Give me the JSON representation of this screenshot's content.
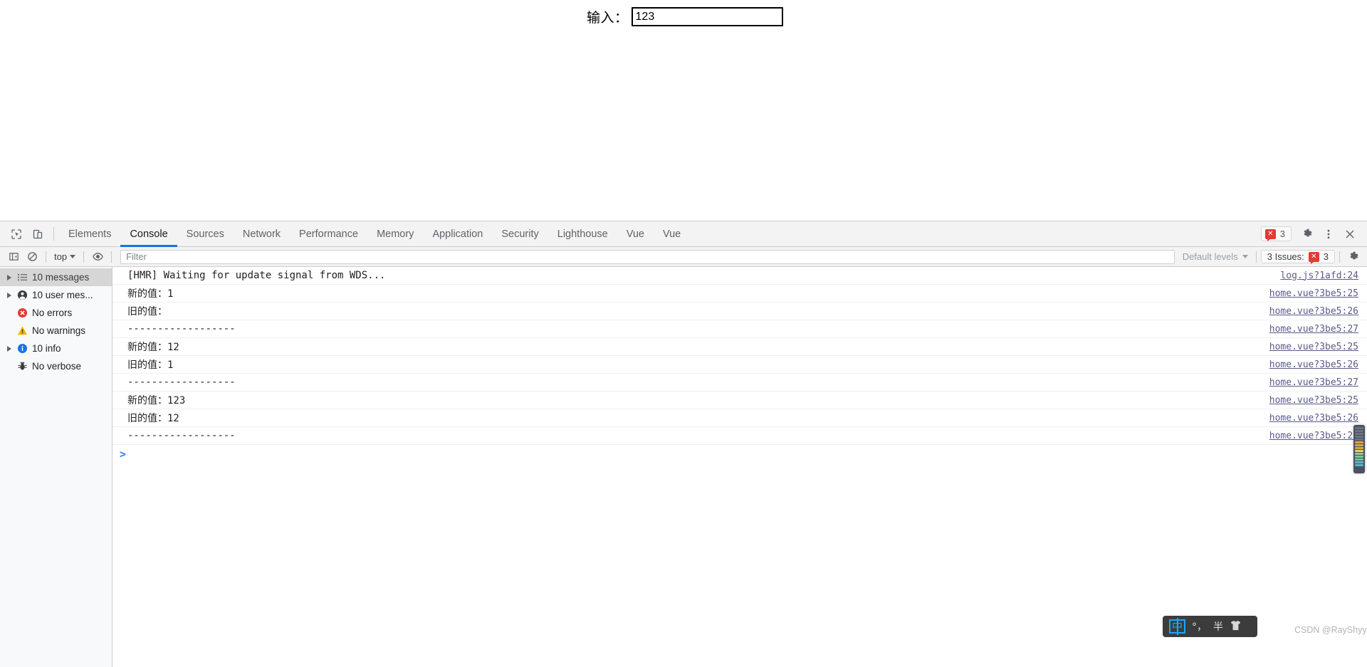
{
  "page": {
    "label": "输入：",
    "input_value": "123",
    "input_placeholder": ""
  },
  "devtools": {
    "tabs": [
      {
        "label": "Elements",
        "active": false
      },
      {
        "label": "Console",
        "active": true
      },
      {
        "label": "Sources",
        "active": false
      },
      {
        "label": "Network",
        "active": false
      },
      {
        "label": "Performance",
        "active": false
      },
      {
        "label": "Memory",
        "active": false
      },
      {
        "label": "Application",
        "active": false
      },
      {
        "label": "Security",
        "active": false
      },
      {
        "label": "Lighthouse",
        "active": false
      },
      {
        "label": "Vue",
        "active": false
      },
      {
        "label": "Vue",
        "active": false
      }
    ],
    "header_icons": {
      "inspect": "inspect-element-icon",
      "device": "device-toolbar-icon",
      "settings": "gear-icon",
      "more": "more-options-icon",
      "close": "close-icon"
    },
    "error_badge": {
      "count": "3",
      "icon": "error-icon"
    },
    "toolbar": {
      "sidebar_toggle": "console-sidebar-toggle-icon",
      "clear_console": "clear-console-icon",
      "context": "top",
      "eye": "live-expression-icon",
      "filter_placeholder": "Filter",
      "filter_value": "",
      "levels_label": "Default levels",
      "issues_label": "3 Issues:",
      "issues_count": "3",
      "settings": "gear-icon"
    },
    "sidebar": [
      {
        "label": "10 messages",
        "icon": "list-icon",
        "arrow": true,
        "selected": true,
        "color": "#5f6368"
      },
      {
        "label": "10 user mes...",
        "icon": "user-icon",
        "arrow": true,
        "selected": false,
        "color": "#3c4043"
      },
      {
        "label": "No errors",
        "icon": "error-icon",
        "arrow": false,
        "selected": false,
        "color": "#e53935"
      },
      {
        "label": "No warnings",
        "icon": "warning-icon",
        "arrow": false,
        "selected": false,
        "color": "#f5b400"
      },
      {
        "label": "10 info",
        "icon": "info-icon",
        "arrow": true,
        "selected": false,
        "color": "#1a73e8"
      },
      {
        "label": "No verbose",
        "icon": "bug-icon",
        "arrow": false,
        "selected": false,
        "color": "#5f6368"
      }
    ],
    "messages": [
      {
        "text": "[HMR] Waiting for update signal from WDS...",
        "source": "log.js?1afd:24"
      },
      {
        "text": "新的值：1",
        "source": "home.vue?3be5:25"
      },
      {
        "text": "旧的值：",
        "source": "home.vue?3be5:26"
      },
      {
        "text": "------------------",
        "source": "home.vue?3be5:27"
      },
      {
        "text": "新的值：12",
        "source": "home.vue?3be5:25"
      },
      {
        "text": "旧的值：1",
        "source": "home.vue?3be5:26"
      },
      {
        "text": "------------------",
        "source": "home.vue?3be5:27"
      },
      {
        "text": "新的值：123",
        "source": "home.vue?3be5:25"
      },
      {
        "text": "旧的值：12",
        "source": "home.vue?3be5:26"
      },
      {
        "text": "------------------",
        "source": "home.vue?3be5:27"
      }
    ],
    "prompt": ">"
  },
  "ime": {
    "mode": "中",
    "punctuation": "°，",
    "width": "半",
    "skin": "shirt-icon"
  },
  "watermark": "CSDN @RayShyy",
  "colors": {
    "accent": "#1a73e8",
    "error": "#e53935",
    "warning": "#f5b400",
    "toolbar_bg": "#f3f3f3",
    "sidebar_bg": "#f8f9fa",
    "border": "#cdcdcd",
    "link": "#5a5a8c"
  }
}
